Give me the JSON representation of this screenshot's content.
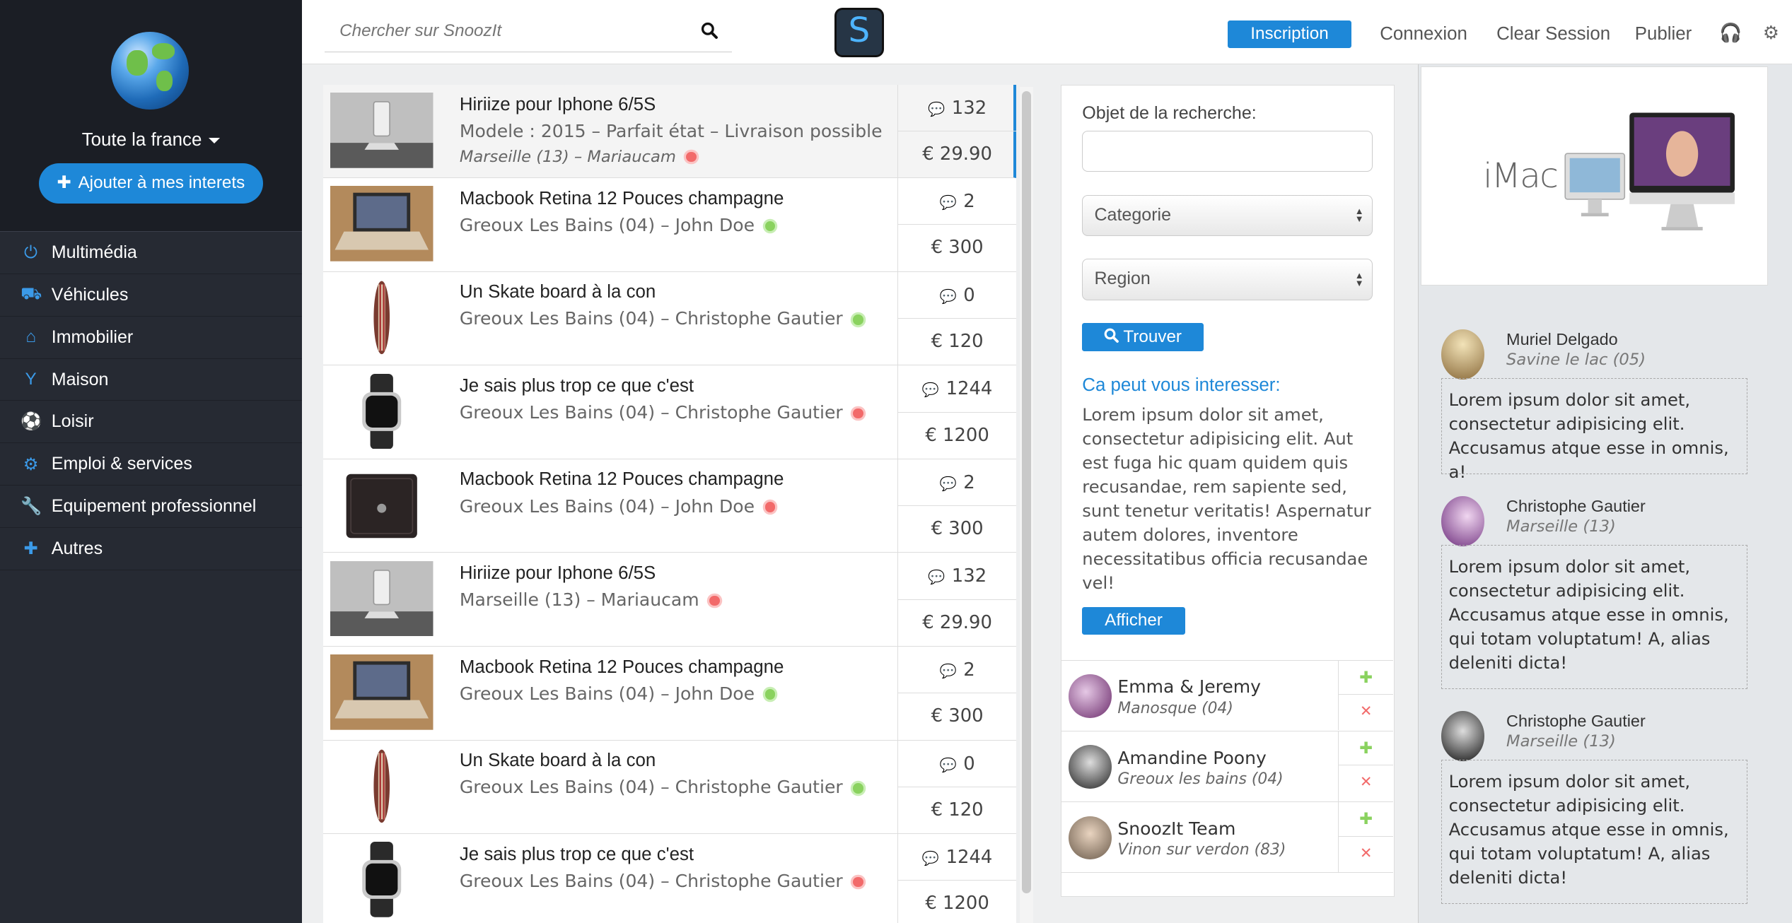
{
  "sidebar": {
    "region": "Toute la france",
    "interest_button": "Ajouter à mes interets",
    "items": [
      {
        "label": "Multimédia",
        "icon": "power-icon"
      },
      {
        "label": "Véhicules",
        "icon": "car-icon"
      },
      {
        "label": "Immobilier",
        "icon": "home-icon"
      },
      {
        "label": "Maison",
        "icon": "glass-icon"
      },
      {
        "label": "Loisir",
        "icon": "soccer-ball-icon"
      },
      {
        "label": "Emploi & services",
        "icon": "gear-icon"
      },
      {
        "label": "Equipement professionnel",
        "icon": "wrench-icon"
      },
      {
        "label": "Autres",
        "icon": "plus-icon"
      }
    ]
  },
  "topbar": {
    "search_placeholder": "Chercher sur SnoozIt",
    "logo_letter": "S",
    "inscription": "Inscription",
    "connexion": "Connexion",
    "clear_session": "Clear Session",
    "publier": "Publier"
  },
  "listings": [
    {
      "title": "Hiriize pour Iphone 6/5S",
      "line2": "Modele : 2015 – Parfait état – Livraison possible",
      "line3": "Marseille (13) – Mariaucam",
      "status": "red",
      "comments": "132",
      "price": "€ 29.90",
      "thumb": "phone-stand"
    },
    {
      "title": "Macbook Retina 12 Pouces champagne",
      "line2": "Greoux Les Bains (04) – John Doe",
      "status": "green",
      "comments": "2",
      "price": "€ 300",
      "thumb": "laptop"
    },
    {
      "title": "Un Skate board à la con",
      "line2": "Greoux Les Bains (04) – Christophe Gautier",
      "status": "green",
      "comments": "0",
      "price": "€ 120",
      "thumb": "skateboard"
    },
    {
      "title": "Je sais plus trop ce que c'est",
      "line2": "Greoux Les Bains (04) – Christophe Gautier",
      "status": "red",
      "comments": "1244",
      "price": "€ 1200",
      "thumb": "watch"
    },
    {
      "title": "Macbook Retina 12 Pouces champagne",
      "line2": "Greoux Les Bains (04) – John Doe",
      "status": "red",
      "comments": "2",
      "price": "€ 300",
      "thumb": "wallet"
    },
    {
      "title": "Hiriize pour Iphone 6/5S",
      "line2": "Marseille (13) – Mariaucam",
      "status": "red",
      "comments": "132",
      "price": "€ 29.90",
      "thumb": "phone-stand"
    },
    {
      "title": "Macbook Retina 12 Pouces champagne",
      "line2": "Greoux Les Bains (04) – John Doe",
      "status": "green",
      "comments": "2",
      "price": "€ 300",
      "thumb": "laptop"
    },
    {
      "title": "Un Skate board à la con",
      "line2": "Greoux Les Bains (04) – Christophe Gautier",
      "status": "green",
      "comments": "0",
      "price": "€ 120",
      "thumb": "skateboard"
    },
    {
      "title": "Je sais plus trop ce que c'est",
      "line2": "Greoux Les Bains (04) – Christophe Gautier",
      "status": "red",
      "comments": "1244",
      "price": "€ 1200",
      "thumb": "watch"
    }
  ],
  "search_panel": {
    "object_label": "Objet de la recherche:",
    "category": "Categorie",
    "region": "Region",
    "find_button": "Trouver",
    "interest_title": "Ca peut vous interesser:",
    "lorem": "Lorem ipsum dolor sit amet, consectetur adipisicing elit. Aut est fuga hic quam quidem quis recusandae, rem sapiente sed, sunt tenetur veritatis! Aspernatur autem dolores, inventore necessitatibus officia recusandae vel!",
    "show_button": "Afficher"
  },
  "suggestions": [
    {
      "name": "Emma & Jeremy",
      "location": "Manosque (04)"
    },
    {
      "name": "Amandine Poony",
      "location": "Greoux les bains (04)"
    },
    {
      "name": "SnoozIt Team",
      "location": "Vinon sur verdon (83)"
    }
  ],
  "ad": {
    "brand": "iMac"
  },
  "people": [
    {
      "name": "Muriel Delgado",
      "location": "Savine le lac (05)",
      "message": "Lorem ipsum dolor sit amet, consectetur adipisicing elit. Accusamus atque esse in omnis, a!"
    },
    {
      "name": "Christophe Gautier",
      "location": "Marseille (13)",
      "message": "Lorem ipsum dolor sit amet, consectetur adipisicing elit. Accusamus atque esse in omnis, qui totam voluptatum! A, alias deleniti dicta!"
    },
    {
      "name": "Christophe Gautier",
      "location": "Marseille (13)",
      "message": "Lorem ipsum dolor sit amet, consectetur adipisicing elit. Accusamus atque esse in omnis, qui totam voluptatum! A, alias deleniti dicta!"
    }
  ],
  "colors": {
    "accent": "#1e88d8",
    "sidebar": "#262a33",
    "online": "#8ad25f",
    "offline": "#f26a6a"
  }
}
